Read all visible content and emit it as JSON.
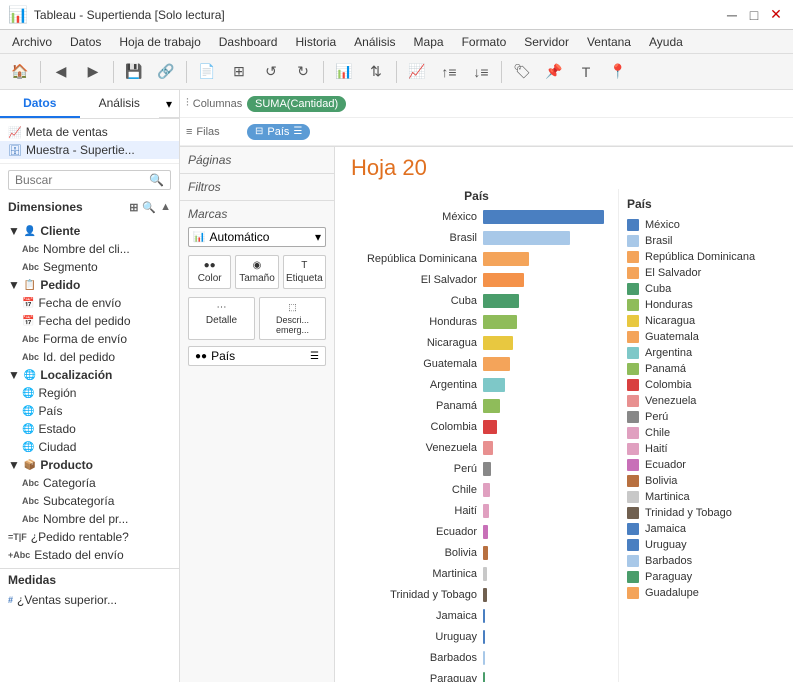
{
  "window": {
    "title": "Tableau - Supertienda [Solo lectura]"
  },
  "menu": {
    "items": [
      "Archivo",
      "Datos",
      "Hoja de trabajo",
      "Dashboard",
      "Historia",
      "Análisis",
      "Mapa",
      "Formato",
      "Servidor",
      "Ventana",
      "Ayuda"
    ]
  },
  "left_panel": {
    "tabs": [
      "Datos",
      "Análisis"
    ],
    "active_tab": "Datos",
    "items": [
      {
        "label": "Meta de ventas",
        "type": "chart"
      },
      {
        "label": "Muestra - Supertie...",
        "type": "db"
      }
    ],
    "search_placeholder": "Buscar",
    "dimensions_label": "Dimensiones",
    "groups": [
      {
        "name": "Cliente",
        "items": [
          {
            "label": "Nombre del cli...",
            "type": "abc"
          },
          {
            "label": "Segmento",
            "type": "abc"
          }
        ]
      },
      {
        "name": "Pedido",
        "items": [
          {
            "label": "Fecha de envío",
            "type": "date"
          },
          {
            "label": "Fecha del pedido",
            "type": "date"
          },
          {
            "label": "Forma de envío",
            "type": "abc"
          },
          {
            "label": "Id. del pedido",
            "type": "abc"
          }
        ]
      },
      {
        "name": "Localización",
        "items": [
          {
            "label": "Región",
            "type": "globe"
          },
          {
            "label": "País",
            "type": "globe"
          },
          {
            "label": "Estado",
            "type": "globe"
          },
          {
            "label": "Ciudad",
            "type": "globe"
          }
        ]
      },
      {
        "name": "Producto",
        "items": [
          {
            "label": "Categoría",
            "type": "abc"
          },
          {
            "label": "Subcategoría",
            "type": "abc"
          },
          {
            "label": "Nombre del pr...",
            "type": "abc"
          }
        ]
      }
    ],
    "special_items": [
      {
        "label": "¿Pedido rentable?",
        "type": "tf"
      },
      {
        "label": "Estado del envío",
        "type": "abc2"
      }
    ],
    "measures_label": "Medidas",
    "measures": [
      {
        "label": "¿Ventas superior...",
        "type": "measure"
      }
    ]
  },
  "middle_panel": {
    "pages_label": "Páginas",
    "filters_label": "Filtros",
    "marks_label": "Marcas",
    "marks_type": "Automático",
    "marks_buttons": [
      {
        "label": "Color",
        "icon": "●●"
      },
      {
        "label": "Tamaño",
        "icon": "◉"
      },
      {
        "label": "Etiqueta",
        "icon": "T"
      }
    ],
    "marks_detail": {
      "label": "Detalle",
      "icon": "⋯"
    },
    "marks_emergente": {
      "label": "Descri...\nemerg...",
      "icon": "⬚"
    },
    "marks_country": {
      "label": "País",
      "icon": "●●"
    }
  },
  "shelves": {
    "columns_label": "Columnas",
    "columns_icon": "|||",
    "rows_label": "Filas",
    "rows_icon": "≡",
    "columns_pill": "SUMA(Cantidad)",
    "rows_pill": "País"
  },
  "sheet": {
    "title": "Hoja 20",
    "x_axis_label": "País"
  },
  "legend": {
    "title": "País",
    "items": [
      {
        "label": "México",
        "color": "#4a7fc1"
      },
      {
        "label": "Brasil",
        "color": "#a8c8e8"
      },
      {
        "label": "República Dominicana",
        "color": "#f4a45a"
      },
      {
        "label": "El Salvador",
        "color": "#f4a45a"
      },
      {
        "label": "Cuba",
        "color": "#4a9d6b"
      },
      {
        "label": "Honduras",
        "color": "#8fbc5a"
      },
      {
        "label": "Nicaragua",
        "color": "#e8c840"
      },
      {
        "label": "Guatemala",
        "color": "#f4a45a"
      },
      {
        "label": "Argentina",
        "color": "#7ec8c8"
      },
      {
        "label": "Panamá",
        "color": "#8fbc5a"
      },
      {
        "label": "Colombia",
        "color": "#d94040"
      },
      {
        "label": "Venezuela",
        "color": "#e89090"
      },
      {
        "label": "Perú",
        "color": "#888888"
      },
      {
        "label": "Chile",
        "color": "#e0a0c0"
      },
      {
        "label": "Haití",
        "color": "#e0a0c0"
      },
      {
        "label": "Ecuador",
        "color": "#c870b8"
      },
      {
        "label": "Bolivia",
        "color": "#b87040"
      },
      {
        "label": "Martinica",
        "color": "#c8c8c8"
      },
      {
        "label": "Trinidad y Tobago",
        "color": "#706050"
      },
      {
        "label": "Jamaica",
        "color": "#4a7fc1"
      },
      {
        "label": "Uruguay",
        "color": "#4a7fc1"
      },
      {
        "label": "Barbados",
        "color": "#a8c8e8"
      },
      {
        "label": "Paraguay",
        "color": "#4a9d6b"
      },
      {
        "label": "Guadalupe",
        "color": "#f4a45a"
      }
    ]
  },
  "bars": [
    {
      "label": "México",
      "value": 100,
      "color": "#4a7fc1"
    },
    {
      "label": "Brasil",
      "value": 72,
      "color": "#a8c8e8"
    },
    {
      "label": "República Dominicana",
      "value": 38,
      "color": "#f4a45a"
    },
    {
      "label": "El Salvador",
      "value": 34,
      "color": "#f4924a"
    },
    {
      "label": "Cuba",
      "value": 30,
      "color": "#4a9d6b"
    },
    {
      "label": "Honduras",
      "value": 28,
      "color": "#8fbc5a"
    },
    {
      "label": "Nicaragua",
      "value": 25,
      "color": "#e8c840"
    },
    {
      "label": "Guatemala",
      "value": 22,
      "color": "#f4a45a"
    },
    {
      "label": "Argentina",
      "value": 18,
      "color": "#7ec8c8"
    },
    {
      "label": "Panamá",
      "value": 14,
      "color": "#8fbc5a"
    },
    {
      "label": "Colombia",
      "value": 12,
      "color": "#d94040"
    },
    {
      "label": "Venezuela",
      "value": 8,
      "color": "#e89090"
    },
    {
      "label": "Perú",
      "value": 7,
      "color": "#888888"
    },
    {
      "label": "Chile",
      "value": 6,
      "color": "#e0a0c0"
    },
    {
      "label": "Haití",
      "value": 5,
      "color": "#e0a0c0"
    },
    {
      "label": "Ecuador",
      "value": 4,
      "color": "#c870b8"
    },
    {
      "label": "Bolivia",
      "value": 4,
      "color": "#b87040"
    },
    {
      "label": "Martinica",
      "value": 3,
      "color": "#c8c8c8"
    },
    {
      "label": "Trinidad y Tobago",
      "value": 3,
      "color": "#706050"
    },
    {
      "label": "Jamaica",
      "value": 2,
      "color": "#4a7fc1"
    },
    {
      "label": "Uruguay",
      "value": 2,
      "color": "#4a7fc1"
    },
    {
      "label": "Barbados",
      "value": 2,
      "color": "#a8c8e8"
    },
    {
      "label": "Paraguay",
      "value": 1,
      "color": "#4a9d6b"
    }
  ]
}
